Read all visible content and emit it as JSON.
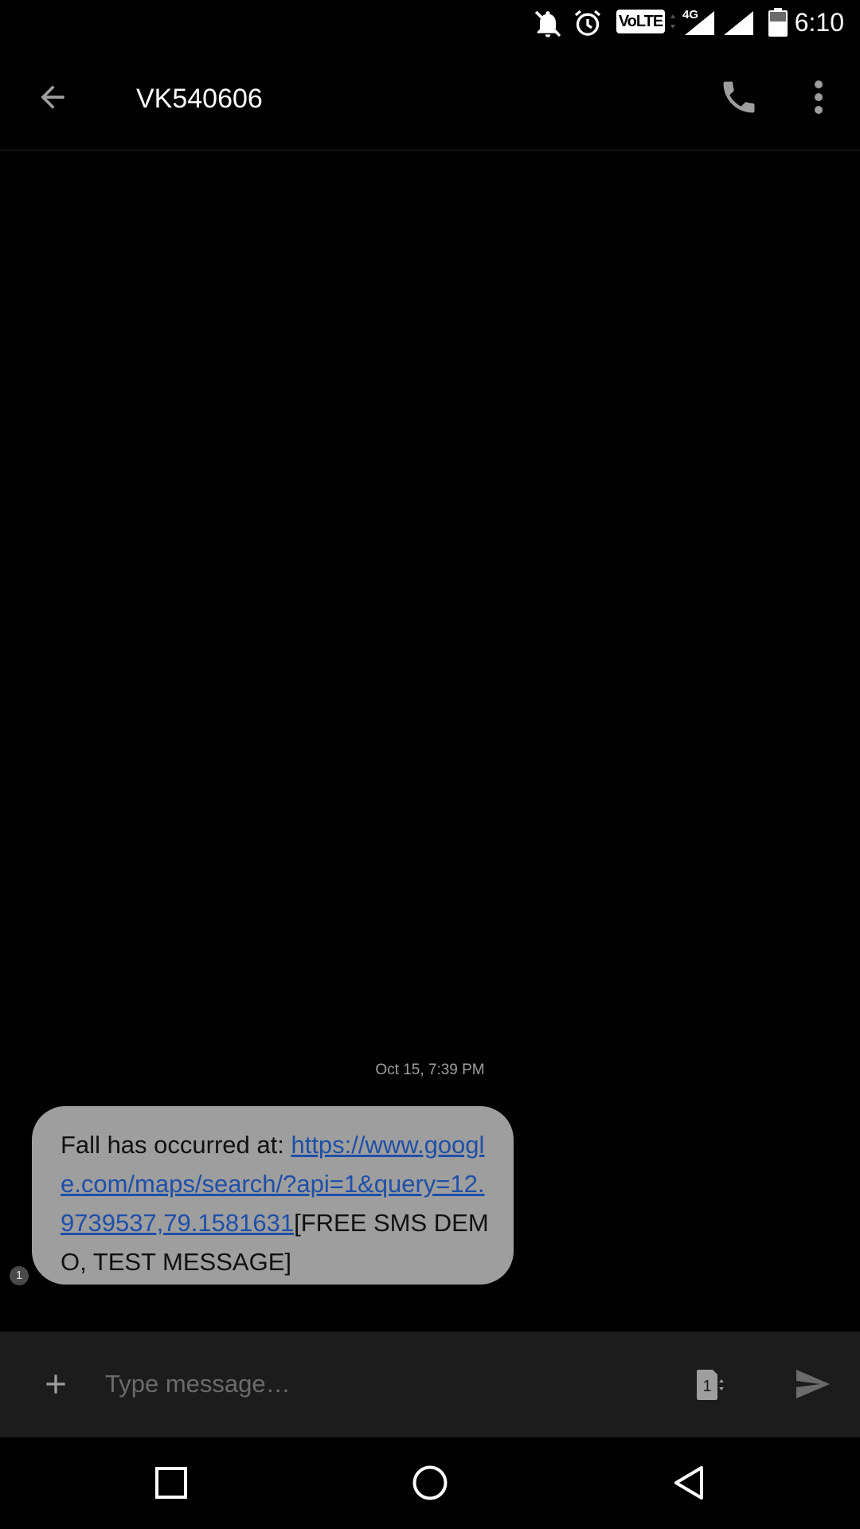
{
  "status_bar": {
    "time": "6:10",
    "volte_label": "VoLTE",
    "network_type": "4G",
    "icons": [
      "notifications-off-icon",
      "alarm-icon",
      "volte-icon",
      "signal-icon",
      "signal-icon",
      "battery-icon"
    ]
  },
  "toolbar": {
    "contact": "VK540606",
    "back_icon": "arrow-back-icon",
    "call_icon": "phone-icon",
    "more_icon": "more-vert-icon"
  },
  "conversation": {
    "timestamp": "Oct 15, 7:39 PM",
    "messages": [
      {
        "prefix": "Fall has occurred at: ",
        "link": "https://www.google.com/maps/search/?api=1&query=12.9739537,79.1581631",
        "suffix": "[FREE SMS DEMO, TEST MESSAGE]",
        "sim": "1"
      }
    ]
  },
  "composer": {
    "placeholder": "Type message…",
    "sim_label": "1",
    "attach_icon": "add-icon",
    "send_icon": "send-icon"
  },
  "nav_bar": {
    "icons": [
      "recents-icon",
      "home-icon",
      "back-icon"
    ]
  },
  "colors": {
    "background": "#000000",
    "bubble": "#9e9e9e",
    "link": "#1f4fa8",
    "composer": "#1c1c1c",
    "icon": "#9e9e9e"
  }
}
